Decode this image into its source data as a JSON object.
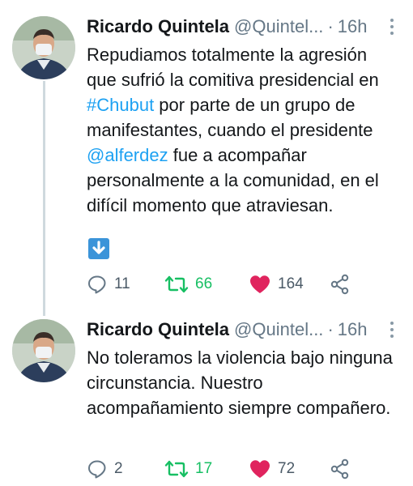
{
  "colors": {
    "text": "#14171a",
    "secondary": "#657786",
    "link": "#1da1f2",
    "retweet": "#17bf63",
    "like": "#e0245e",
    "thread_line": "#cfd9de"
  },
  "tweets": [
    {
      "author": {
        "display_name": "Ricardo Quintela",
        "handle": "@Quintel...",
        "separator": "·",
        "time": "16h"
      },
      "text": {
        "part1": "Repudiamos totalmente la agresión que sufrió la comitiva presidencial en ",
        "hashtag": "#Chubut",
        "part2": " por parte de un grupo de manifestantes, cuando el presidente ",
        "mention": "@alferdez",
        "part3": " fue a acompañar personalmente a la comunidad, en el difícil momento que atraviesan."
      },
      "media_icon": "download-arrow-icon",
      "stats": {
        "replies": "11",
        "retweets": "66",
        "likes": "164"
      },
      "retweeted": true,
      "liked": true
    },
    {
      "author": {
        "display_name": "Ricardo Quintela",
        "handle": "@Quintel...",
        "separator": "·",
        "time": "16h"
      },
      "text": {
        "body": "No toleramos la violencia bajo ninguna circunstancia. Nuestro acompañamiento siempre compañero."
      },
      "stats": {
        "replies": "2",
        "retweets": "17",
        "likes": "72"
      },
      "retweeted": true,
      "liked": true
    }
  ]
}
